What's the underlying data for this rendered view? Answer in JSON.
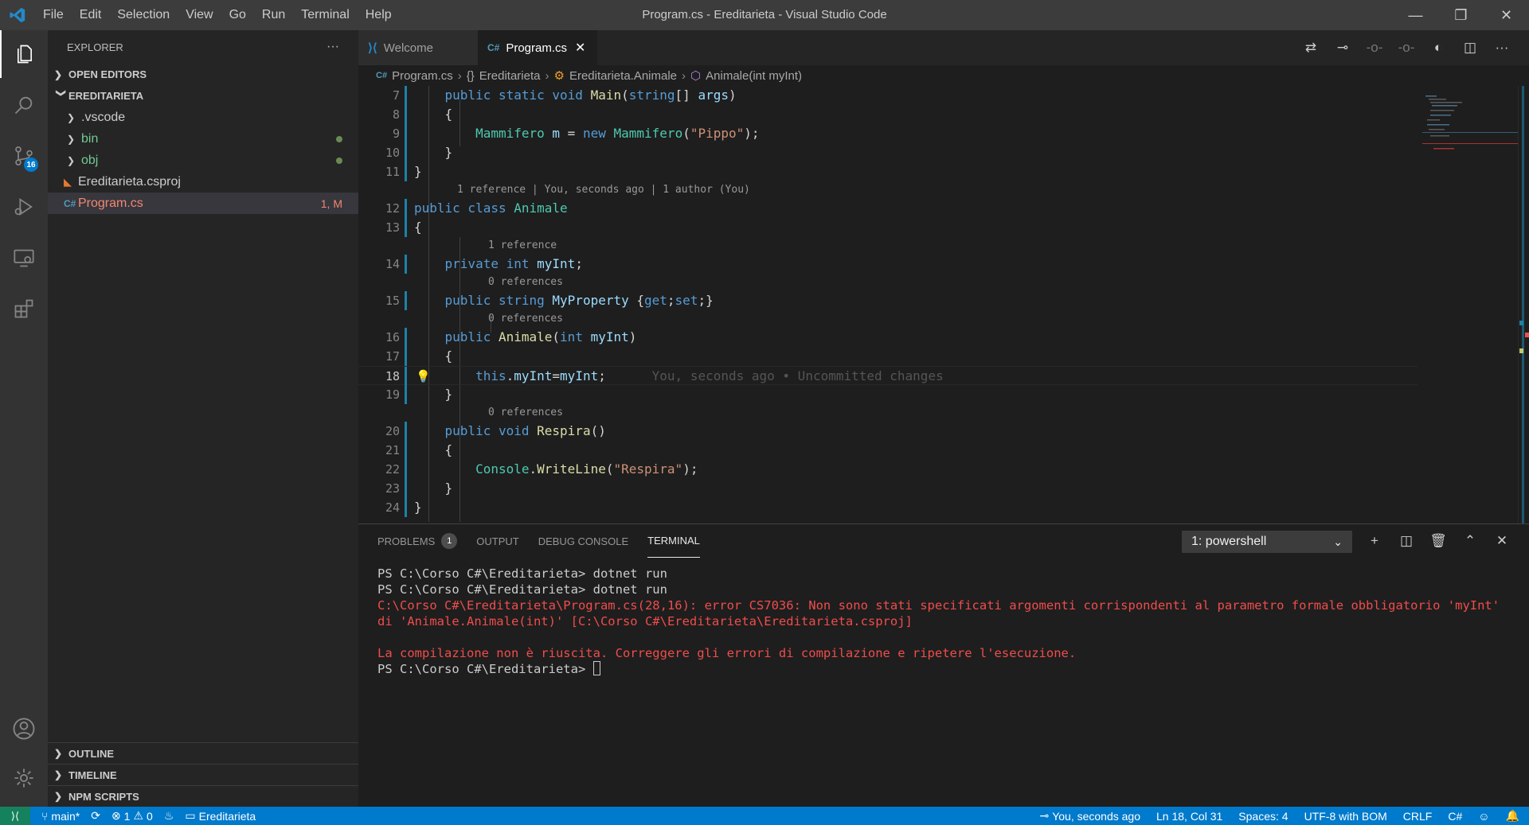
{
  "window": {
    "title": "Program.cs - Ereditarieta - Visual Studio Code",
    "menu": [
      "File",
      "Edit",
      "Selection",
      "View",
      "Go",
      "Run",
      "Terminal",
      "Help"
    ]
  },
  "activity": {
    "scm_badge": "16"
  },
  "sidebar": {
    "header": "EXPLORER",
    "more": "···",
    "open_editors": "OPEN EDITORS",
    "folder": "EREDITARIETA",
    "items": [
      {
        "label": ".vscode",
        "type": "folder"
      },
      {
        "label": "bin",
        "type": "folder"
      },
      {
        "label": "obj",
        "type": "folder"
      },
      {
        "label": "Ereditarieta.csproj",
        "type": "file"
      },
      {
        "label": "Program.cs",
        "type": "file",
        "status": "1, M"
      }
    ],
    "outline": "OUTLINE",
    "timeline": "TIMELINE",
    "npm": "NPM SCRIPTS"
  },
  "tabs": [
    {
      "label": "Welcome"
    },
    {
      "label": "Program.cs",
      "close": "✕"
    }
  ],
  "breadcrumb": [
    "Program.cs",
    "Ereditarieta",
    "Ereditarieta.Animale",
    "Animale(int myInt)"
  ],
  "editor": {
    "lines": [
      {
        "n": "7",
        "code": "    public static void Main(string[] args)"
      },
      {
        "n": "8",
        "code": "    {"
      },
      {
        "n": "9",
        "code": "        Mammifero m = new Mammifero(\"Pippo\");"
      },
      {
        "n": "10",
        "code": "    }"
      },
      {
        "n": "11",
        "code": "}"
      },
      {
        "n": "12",
        "code": "public class Animale"
      },
      {
        "n": "13",
        "code": "{"
      },
      {
        "n": "14",
        "code": "    private int myInt;"
      },
      {
        "n": "15",
        "code": "    public string MyProperty {get;set;}"
      },
      {
        "n": "16",
        "code": "    public Animale(int myInt)"
      },
      {
        "n": "17",
        "code": "    {"
      },
      {
        "n": "18",
        "code": "        this.myInt=myInt;"
      },
      {
        "n": "19",
        "code": "    }"
      },
      {
        "n": "20",
        "code": "    public void Respira()"
      },
      {
        "n": "21",
        "code": "    {"
      },
      {
        "n": "22",
        "code": "        Console.WriteLine(\"Respira\");"
      },
      {
        "n": "23",
        "code": "    }"
      },
      {
        "n": "24",
        "code": "}"
      }
    ],
    "lens_class": "1 reference | You, seconds ago | 1 author (You)",
    "lens_one": "1 reference",
    "lens_zero": "0 references",
    "blame": "You, seconds ago • Uncommitted changes"
  },
  "panel": {
    "tabs": [
      "PROBLEMS",
      "OUTPUT",
      "DEBUG CONSOLE",
      "TERMINAL"
    ],
    "problems_count": "1",
    "terminal_select": "1: powershell",
    "terminal_lines": [
      {
        "text": "PS C:\\Corso C#\\Ereditarieta> dotnet run",
        "kind": "normal"
      },
      {
        "text": "PS C:\\Corso C#\\Ereditarieta> dotnet run",
        "kind": "normal"
      },
      {
        "text": "C:\\Corso C#\\Ereditarieta\\Program.cs(28,16): error CS7036: Non sono stati specificati argomenti corrispondenti al parametro formale obbligatorio 'myInt' di 'Animale.Animale(int)' [C:\\Corso C#\\Ereditarieta\\Ereditarieta.csproj]",
        "kind": "error"
      },
      {
        "text": "",
        "kind": "normal"
      },
      {
        "text": "La compilazione non è riuscita. Correggere gli errori di compilazione e ripetere l'esecuzione.",
        "kind": "error"
      },
      {
        "text": "PS C:\\Corso C#\\Ereditarieta> ",
        "kind": "prompt"
      }
    ]
  },
  "status": {
    "branch": "main*",
    "errors": "1",
    "warnings": "0",
    "project": "Ereditarieta",
    "blame": "You, seconds ago",
    "position": "Ln 18, Col 31",
    "spaces": "Spaces: 4",
    "encoding": "UTF-8 with BOM",
    "eol": "CRLF",
    "language": "C#"
  },
  "colors": {
    "accent": "#007acc",
    "error": "#f14c4c",
    "remote": "#16825d"
  }
}
